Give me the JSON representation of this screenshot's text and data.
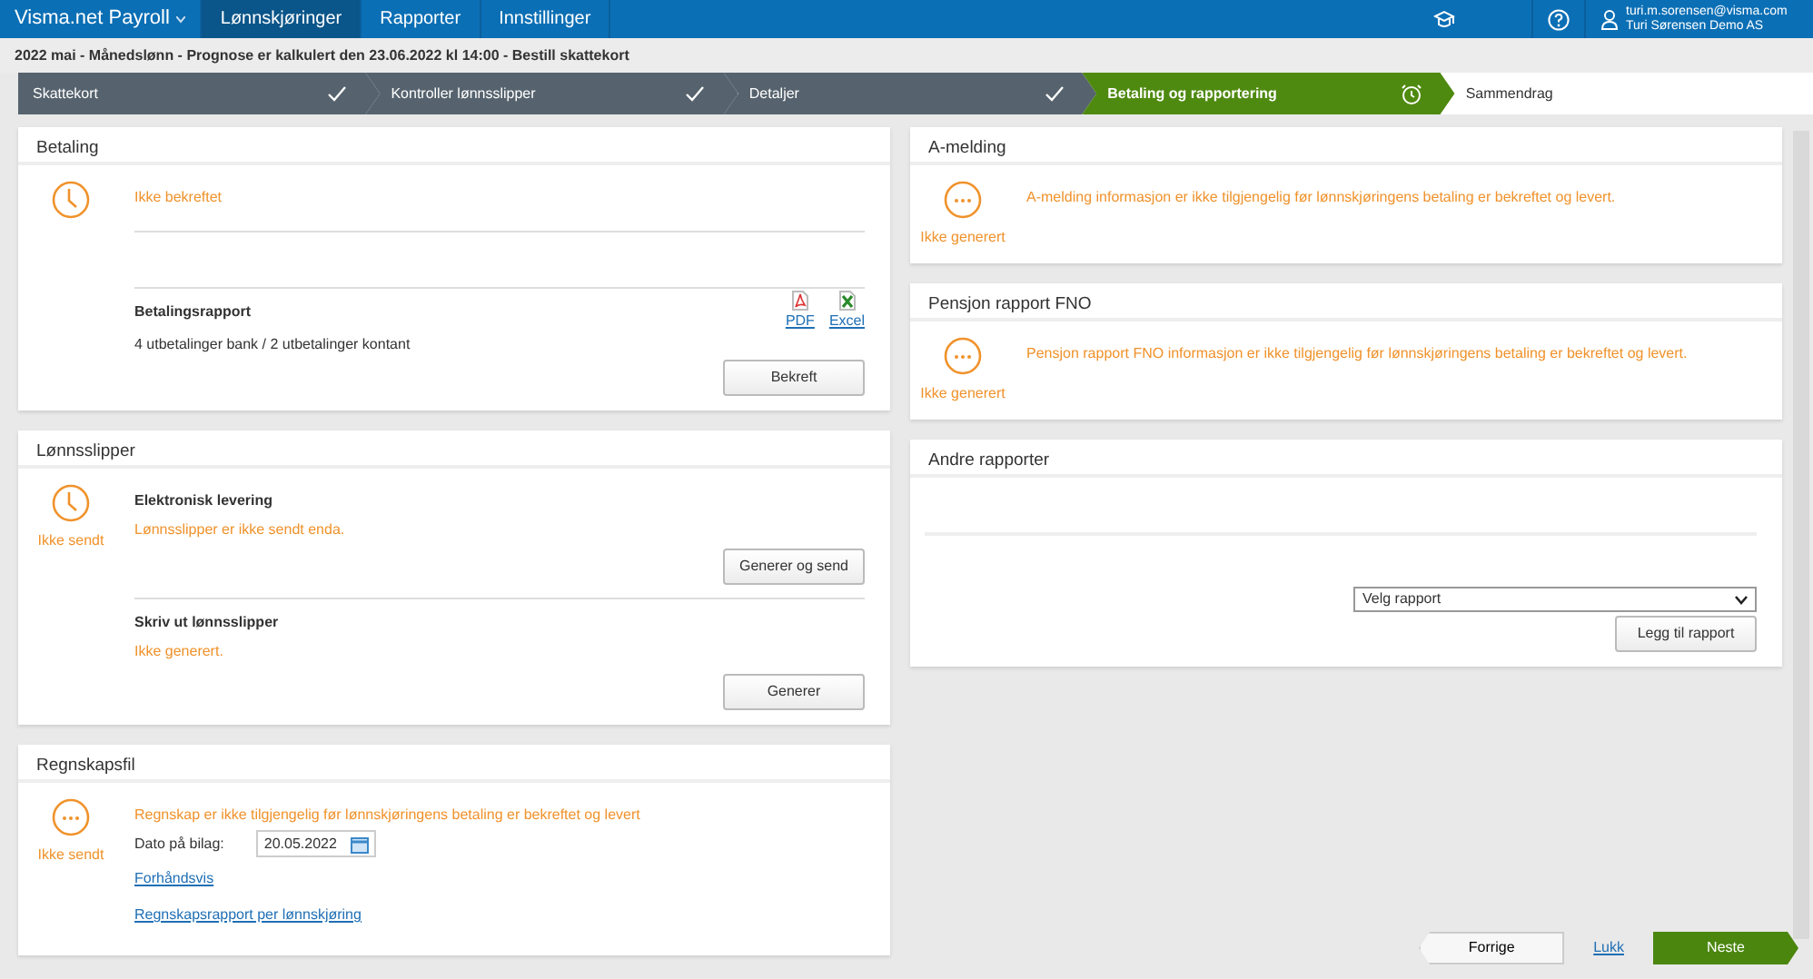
{
  "navbar": {
    "brand": "Visma.net Payroll",
    "tabs": [
      {
        "label": "Lønnskjøringer",
        "selected": true
      },
      {
        "label": "Rapporter",
        "selected": false
      },
      {
        "label": "Innstillinger",
        "selected": false
      }
    ],
    "user_email": "turi.m.sorensen@visma.com",
    "user_company": "Turi Sørensen Demo AS"
  },
  "subheader": "2022 mai - Månedslønn - Prognose er kalkulert den 23.06.2022 kl 14:00 - Bestill skattekort",
  "steps": [
    {
      "label": "Skattekort",
      "kind": "done"
    },
    {
      "label": "Kontroller lønnsslipper",
      "kind": "done"
    },
    {
      "label": "Detaljer",
      "kind": "done"
    },
    {
      "label": "Betaling og rapportering",
      "kind": "active"
    },
    {
      "label": "Sammendrag",
      "kind": "pending"
    }
  ],
  "columns": [
    [
      {
        "title": "Betaling",
        "status": {
          "kind": "clock"
        },
        "blocks": [
          {
            "kind": "message",
            "text": "Ikke bekreftet"
          },
          {
            "kind": "rule"
          },
          {
            "kind": "report",
            "title": "Betalingsrapport",
            "text": "4 utbetalinger bank / 2 utbetalinger kontant",
            "links": [
              {
                "kind": "pdf",
                "label": "PDF"
              },
              {
                "kind": "excel",
                "label": "Excel"
              }
            ]
          },
          {
            "kind": "button",
            "label": "Bekreft"
          }
        ]
      },
      {
        "title": "Lønnsslipper",
        "status": {
          "kind": "clock",
          "label": "Ikke sendt"
        },
        "blocks": [
          {
            "kind": "section",
            "title": "Elektronisk levering",
            "text": "Lønnsslipper er ikke sendt enda.",
            "button": "Generer og send"
          },
          {
            "kind": "section",
            "title": "Skriv ut lønnsslipper",
            "text": "Ikke generert.",
            "button": "Generer"
          }
        ]
      },
      {
        "title": "Regnskapsfil",
        "status": {
          "kind": "dots",
          "label": "Ikke sendt"
        },
        "blocks": [
          {
            "kind": "message",
            "text": "Regnskap er ikke tilgjengelig før lønnskjøringens betaling er bekreftet og levert"
          },
          {
            "kind": "date",
            "label": "Dato på bilag:",
            "value": "20.05.2022"
          },
          {
            "kind": "link",
            "label": "Forhåndsvis"
          },
          {
            "kind": "link",
            "label": "Regnskapsrapport per lønnskjøring"
          }
        ]
      }
    ],
    [
      {
        "title": "A-melding",
        "status": {
          "kind": "dots",
          "label": "Ikke generert"
        },
        "blocks": [
          {
            "kind": "message",
            "text": "A-melding informasjon er ikke tilgjengelig før lønnskjøringens betaling er bekreftet og levert."
          }
        ]
      },
      {
        "title": "Pensjon rapport FNO",
        "status": {
          "kind": "dots",
          "label": "Ikke generert"
        },
        "blocks": [
          {
            "kind": "message",
            "text": "Pensjon rapport FNO informasjon er ikke tilgjengelig før lønnskjøringens betaling er bekreftet og levert."
          }
        ]
      },
      {
        "title": "Andre rapporter",
        "blocks": [
          {
            "kind": "select",
            "value": "Velg rapport"
          },
          {
            "kind": "button",
            "label": "Legg til rapport"
          }
        ]
      }
    ]
  ],
  "footer": {
    "back": "Forrige",
    "close": "Lukk",
    "next": "Neste"
  }
}
